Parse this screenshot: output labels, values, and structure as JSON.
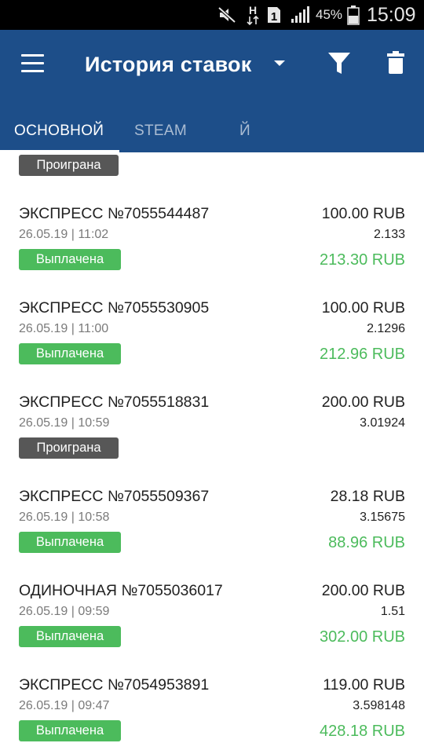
{
  "status_bar": {
    "battery_percent": "45%",
    "time": "15:09",
    "icons": [
      "mute-icon",
      "network-h-icon",
      "sim-1-icon",
      "signal-icon",
      "battery-icon"
    ]
  },
  "header": {
    "title": "История ставок",
    "icons": [
      "menu-icon",
      "dropdown-caret-icon",
      "filter-icon",
      "trash-icon"
    ]
  },
  "tabs": [
    {
      "label": "ОСНОВНОЙ",
      "active": true
    },
    {
      "label": "STEAM",
      "active": false
    },
    {
      "label": "Й",
      "active": false
    }
  ],
  "colors": {
    "appbar": "#1d4e89",
    "won_badge": "#4cbb5c",
    "lost_badge": "#575757",
    "payout": "#4cbb5c"
  },
  "partial_row": {
    "status": "Проиграна"
  },
  "bets": [
    {
      "title": "ЭКСПРЕСС №7055544487",
      "date": "26.05.19 | 11:02",
      "amount": "100.00 RUB",
      "odds": "2.133",
      "status": "Выплачена",
      "payout": "213.30 RUB",
      "won": true
    },
    {
      "title": "ЭКСПРЕСС №7055530905",
      "date": "26.05.19 | 11:00",
      "amount": "100.00 RUB",
      "odds": "2.1296",
      "status": "Выплачена",
      "payout": "212.96 RUB",
      "won": true
    },
    {
      "title": "ЭКСПРЕСС №7055518831",
      "date": "26.05.19 | 10:59",
      "amount": "200.00 RUB",
      "odds": "3.01924",
      "status": "Проиграна",
      "payout": "",
      "won": false
    },
    {
      "title": "ЭКСПРЕСС №7055509367",
      "date": "26.05.19 | 10:58",
      "amount": "28.18 RUB",
      "odds": "3.15675",
      "status": "Выплачена",
      "payout": "88.96 RUB",
      "won": true
    },
    {
      "title": "ОДИНОЧНАЯ №7055036017",
      "date": "26.05.19 | 09:59",
      "amount": "200.00 RUB",
      "odds": "1.51",
      "status": "Выплачена",
      "payout": "302.00 RUB",
      "won": true
    },
    {
      "title": "ЭКСПРЕСС №7054953891",
      "date": "26.05.19 | 09:47",
      "amount": "119.00 RUB",
      "odds": "3.598148",
      "status": "Выплачена",
      "payout": "428.18 RUB",
      "won": true
    }
  ]
}
